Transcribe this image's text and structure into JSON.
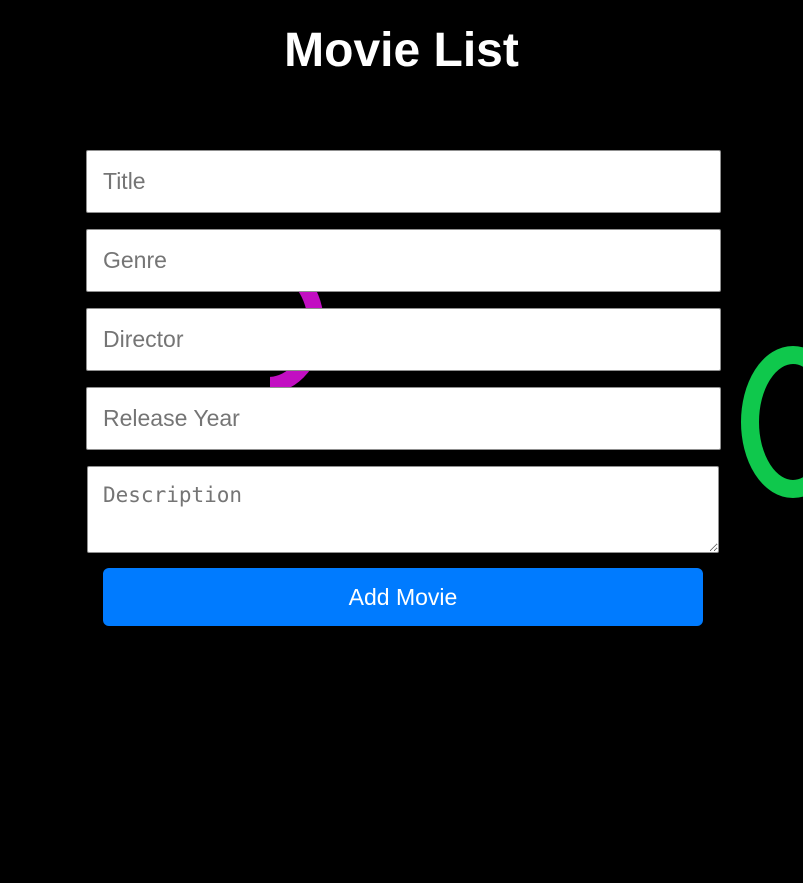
{
  "page": {
    "title": "Movie List"
  },
  "form": {
    "title_placeholder": "Title",
    "genre_placeholder": "Genre",
    "director_placeholder": "Director",
    "release_year_placeholder": "Release Year",
    "description_placeholder": "Description",
    "add_button_label": "Add Movie"
  },
  "colors": {
    "background": "#000000",
    "button": "#007bff",
    "decor_magenta": "#c20ec2",
    "decor_green": "#0fc84c"
  }
}
